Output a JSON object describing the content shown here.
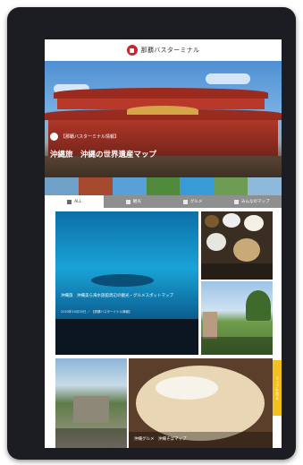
{
  "header": {
    "title": "那覇バスターミナル",
    "logo_icon": "bus-terminal-logo-icon"
  },
  "hero": {
    "author": "【那覇バスターミナル情報】",
    "title": "沖縄旅　沖縄の世界遺産マップ"
  },
  "tabs": [
    {
      "label": "ALL",
      "icon": "grid-icon",
      "active": true
    },
    {
      "label": "観光",
      "icon": "camera-icon",
      "active": false
    },
    {
      "label": "グルメ",
      "icon": "food-icon",
      "active": false
    },
    {
      "label": "みんなのマップ",
      "icon": "share-icon",
      "active": false
    }
  ],
  "cards": [
    {
      "title": "沖縄旅　沖縄美ら海水族館周辺の観光・グルメスポットマップ",
      "meta": "2020年10月30日 ／ 【那覇バスターミナル情報】"
    },
    {
      "title": "",
      "meta": ""
    },
    {
      "title": "",
      "meta": ""
    },
    {
      "title": "",
      "meta": ""
    },
    {
      "title": "沖縄グルメ　沖縄そばマップ",
      "meta": ""
    }
  ],
  "side_tab": {
    "label": "マップを見る"
  },
  "colors": {
    "brand_red": "#c8282d",
    "tab_bar": "#8f8f8f",
    "side_tab": "#f2c11d",
    "device": "#1c1d22"
  }
}
